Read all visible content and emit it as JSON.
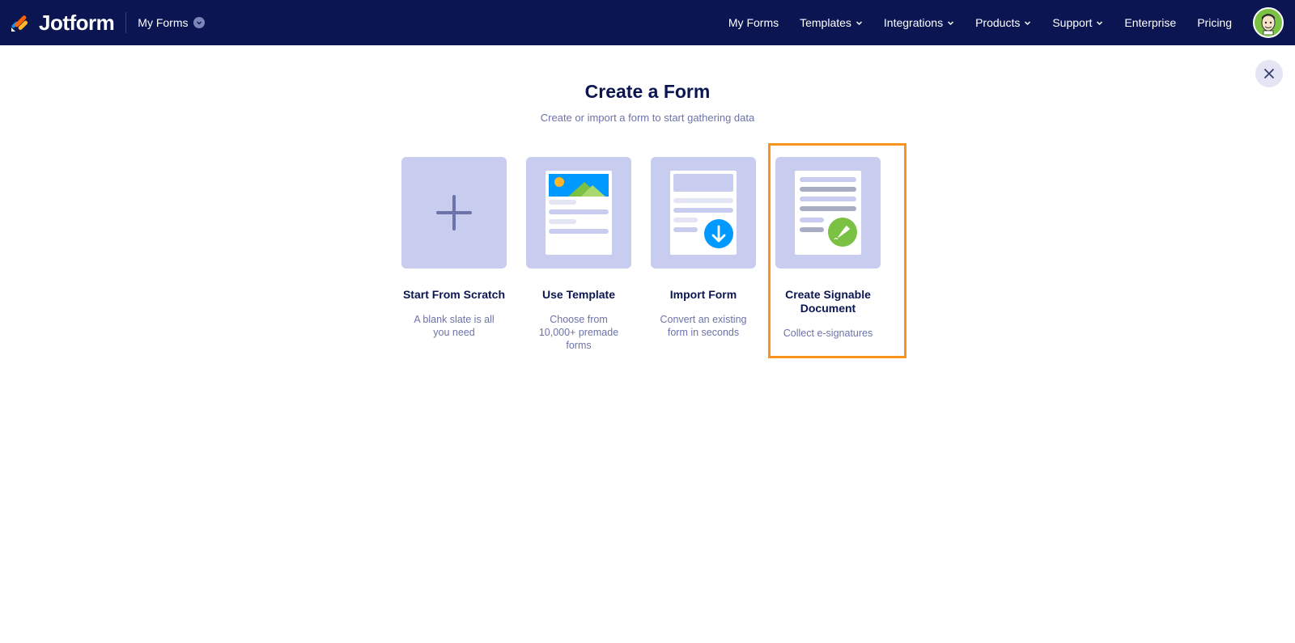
{
  "header": {
    "brand": "Jotform",
    "switcher_label": "My Forms",
    "nav": [
      {
        "label": "My Forms",
        "has_dropdown": false
      },
      {
        "label": "Templates",
        "has_dropdown": true
      },
      {
        "label": "Integrations",
        "has_dropdown": true
      },
      {
        "label": "Products",
        "has_dropdown": true
      },
      {
        "label": "Support",
        "has_dropdown": true
      },
      {
        "label": "Enterprise",
        "has_dropdown": false
      },
      {
        "label": "Pricing",
        "has_dropdown": false
      }
    ]
  },
  "main": {
    "title": "Create a Form",
    "subtitle": "Create or import a form to start gathering data",
    "cards": [
      {
        "title": "Start From Scratch",
        "description": "A blank slate is all you need",
        "icon": "plus-icon"
      },
      {
        "title": "Use Template",
        "description": "Choose from 10,000+ premade forms",
        "icon": "template-icon"
      },
      {
        "title": "Import Form",
        "description": "Convert an existing form in seconds",
        "icon": "import-icon"
      },
      {
        "title": "Create Signable Document",
        "description": "Collect e-signatures",
        "icon": "signature-icon",
        "highlighted": true
      }
    ]
  },
  "colors": {
    "header_bg": "#0a1551",
    "tile_bg": "#c8cdef",
    "highlight": "#f7941d",
    "import_blue": "#0099ff",
    "sign_green": "#7bc143"
  }
}
